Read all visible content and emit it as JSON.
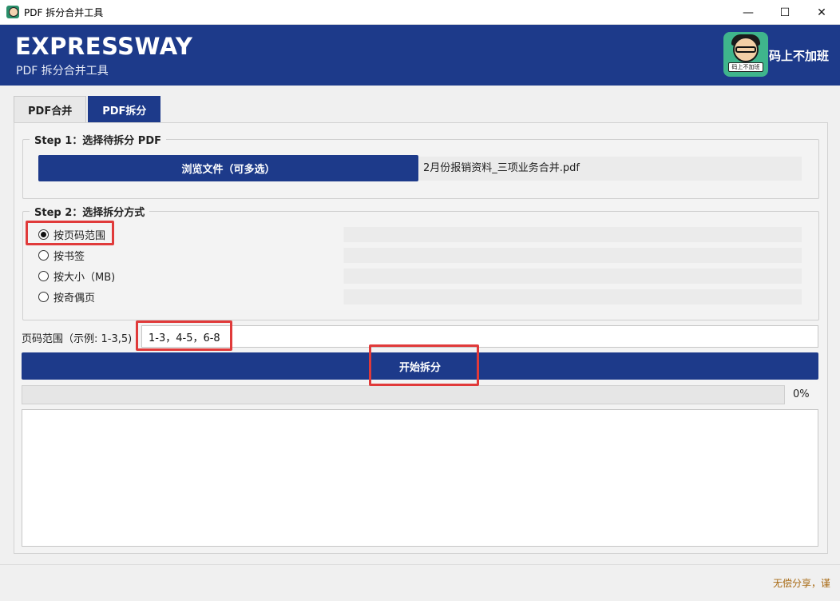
{
  "window": {
    "title": "PDF 拆分合并工具",
    "minimize": "—",
    "maximize": "☐",
    "close": "✕"
  },
  "header": {
    "brand": "EXPRESSWAY",
    "subtitle": "PDF 拆分合并工具",
    "avatar_sign": "码上不加班",
    "right_label": "码上不加班"
  },
  "tabs": [
    {
      "label": "PDF合并",
      "active": false
    },
    {
      "label": "PDF拆分",
      "active": true
    }
  ],
  "step1": {
    "legend": "Step 1：选择待拆分 PDF",
    "browse_label": "浏览文件（可多选）",
    "file_name": "2月份报销资料_三项业务合并.pdf"
  },
  "step2": {
    "legend": "Step 2：选择拆分方式",
    "options": [
      {
        "label": "按页码范围",
        "checked": true
      },
      {
        "label": "按书签",
        "checked": false
      },
      {
        "label": "按大小（MB)",
        "checked": false
      },
      {
        "label": "按奇偶页",
        "checked": false
      }
    ]
  },
  "range": {
    "label": "页码范围（示例: 1-3,5)",
    "value": "1-3，4-5，6-8"
  },
  "start_label": "开始拆分",
  "progress": {
    "value": 0,
    "text": "0%"
  },
  "status": {
    "text": "无偿分享，谨"
  },
  "colors": {
    "accent": "#1d3a8a",
    "highlight": "#e03a3a"
  }
}
